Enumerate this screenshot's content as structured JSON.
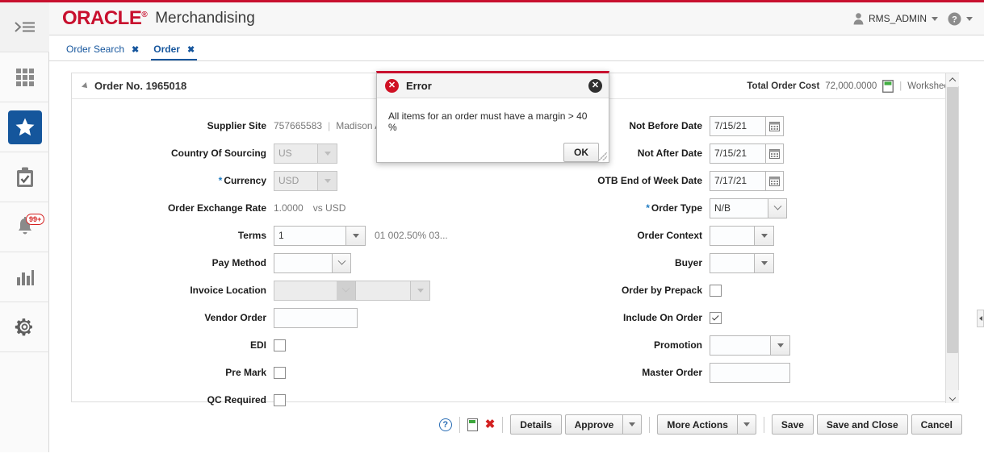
{
  "brand": {
    "logo": "ORACLE",
    "tm": "®",
    "app": "Merchandising",
    "accent": "#c8102e"
  },
  "header": {
    "user": "RMS_ADMIN",
    "user_icon": "user-icon",
    "help_icon": "help-icon"
  },
  "rail": {
    "items": [
      {
        "name": "collapse-menu-icon",
        "label": ""
      },
      {
        "name": "apps-grid-icon",
        "label": ""
      },
      {
        "name": "favorites-star-icon",
        "label": ""
      },
      {
        "name": "tasks-clipboard-icon",
        "label": ""
      },
      {
        "name": "notifications-bell-icon",
        "label": "",
        "badge": "99+"
      },
      {
        "name": "reports-chart-icon",
        "label": ""
      },
      {
        "name": "settings-gear-icon",
        "label": ""
      }
    ]
  },
  "tabs": [
    {
      "label": "Order Search",
      "active": false,
      "close": "✖"
    },
    {
      "label": "Order",
      "active": true,
      "close": "✖"
    }
  ],
  "panel": {
    "title": "Order No. 1965018",
    "total_cost_label": "Total Order Cost",
    "total_cost_value": "72,000.0000",
    "calc_icon": "calculator-icon",
    "separator": "|",
    "status": "Worksheet"
  },
  "form": {
    "left": [
      {
        "label": "Supplier Site",
        "type": "text-pair",
        "value": "757665583",
        "sep": "|",
        "value2": "Madison Aven"
      },
      {
        "label": "Country Of Sourcing",
        "type": "lov-readonly",
        "value": "US"
      },
      {
        "label": "Currency",
        "required": true,
        "type": "lov-readonly",
        "value": "USD"
      },
      {
        "label": "Order Exchange Rate",
        "type": "text-pair",
        "value": "1.0000",
        "value2": "vs USD"
      },
      {
        "label": "Terms",
        "type": "lov",
        "value": "1",
        "suffix": "01 002.50% 03..."
      },
      {
        "label": "Pay Method",
        "type": "select",
        "value": ""
      },
      {
        "label": "Invoice Location",
        "type": "dual-lov-readonly",
        "value": ""
      },
      {
        "label": "Vendor Order",
        "type": "input",
        "value": ""
      },
      {
        "label": "EDI",
        "type": "checkbox",
        "checked": false
      },
      {
        "label": "Pre Mark",
        "type": "checkbox",
        "checked": false
      },
      {
        "label": "QC Required",
        "type": "checkbox",
        "checked": false
      }
    ],
    "right": [
      {
        "label": "Not Before Date",
        "type": "date",
        "value": "7/15/21"
      },
      {
        "label": "Not After Date",
        "type": "date",
        "value": "7/15/21"
      },
      {
        "label": "OTB End of Week Date",
        "type": "date",
        "value": "7/17/21"
      },
      {
        "label": "Order Type",
        "required": true,
        "type": "select",
        "value": "N/B"
      },
      {
        "label": "Order Context",
        "type": "lov",
        "value": ""
      },
      {
        "label": "Buyer",
        "type": "lov",
        "value": ""
      },
      {
        "label": "Order by Prepack",
        "type": "checkbox",
        "checked": false
      },
      {
        "label": "Include On Order",
        "type": "checkbox",
        "checked": true
      },
      {
        "label": "Promotion",
        "type": "lov",
        "value": ""
      },
      {
        "label": "Master Order",
        "type": "input",
        "value": ""
      }
    ]
  },
  "footer": {
    "help_icon": "help-icon",
    "calculator_icon": "calculator-icon",
    "delete_icon": "delete-x-icon",
    "details": "Details",
    "approve": "Approve",
    "more_actions": "More Actions",
    "save": "Save",
    "save_and_close": "Save and Close",
    "cancel": "Cancel"
  },
  "dialog": {
    "icon": "error-icon",
    "title": "Error",
    "close_icon": "close-icon",
    "message": "All items for an order must have a margin > 40 %",
    "ok": "OK"
  }
}
